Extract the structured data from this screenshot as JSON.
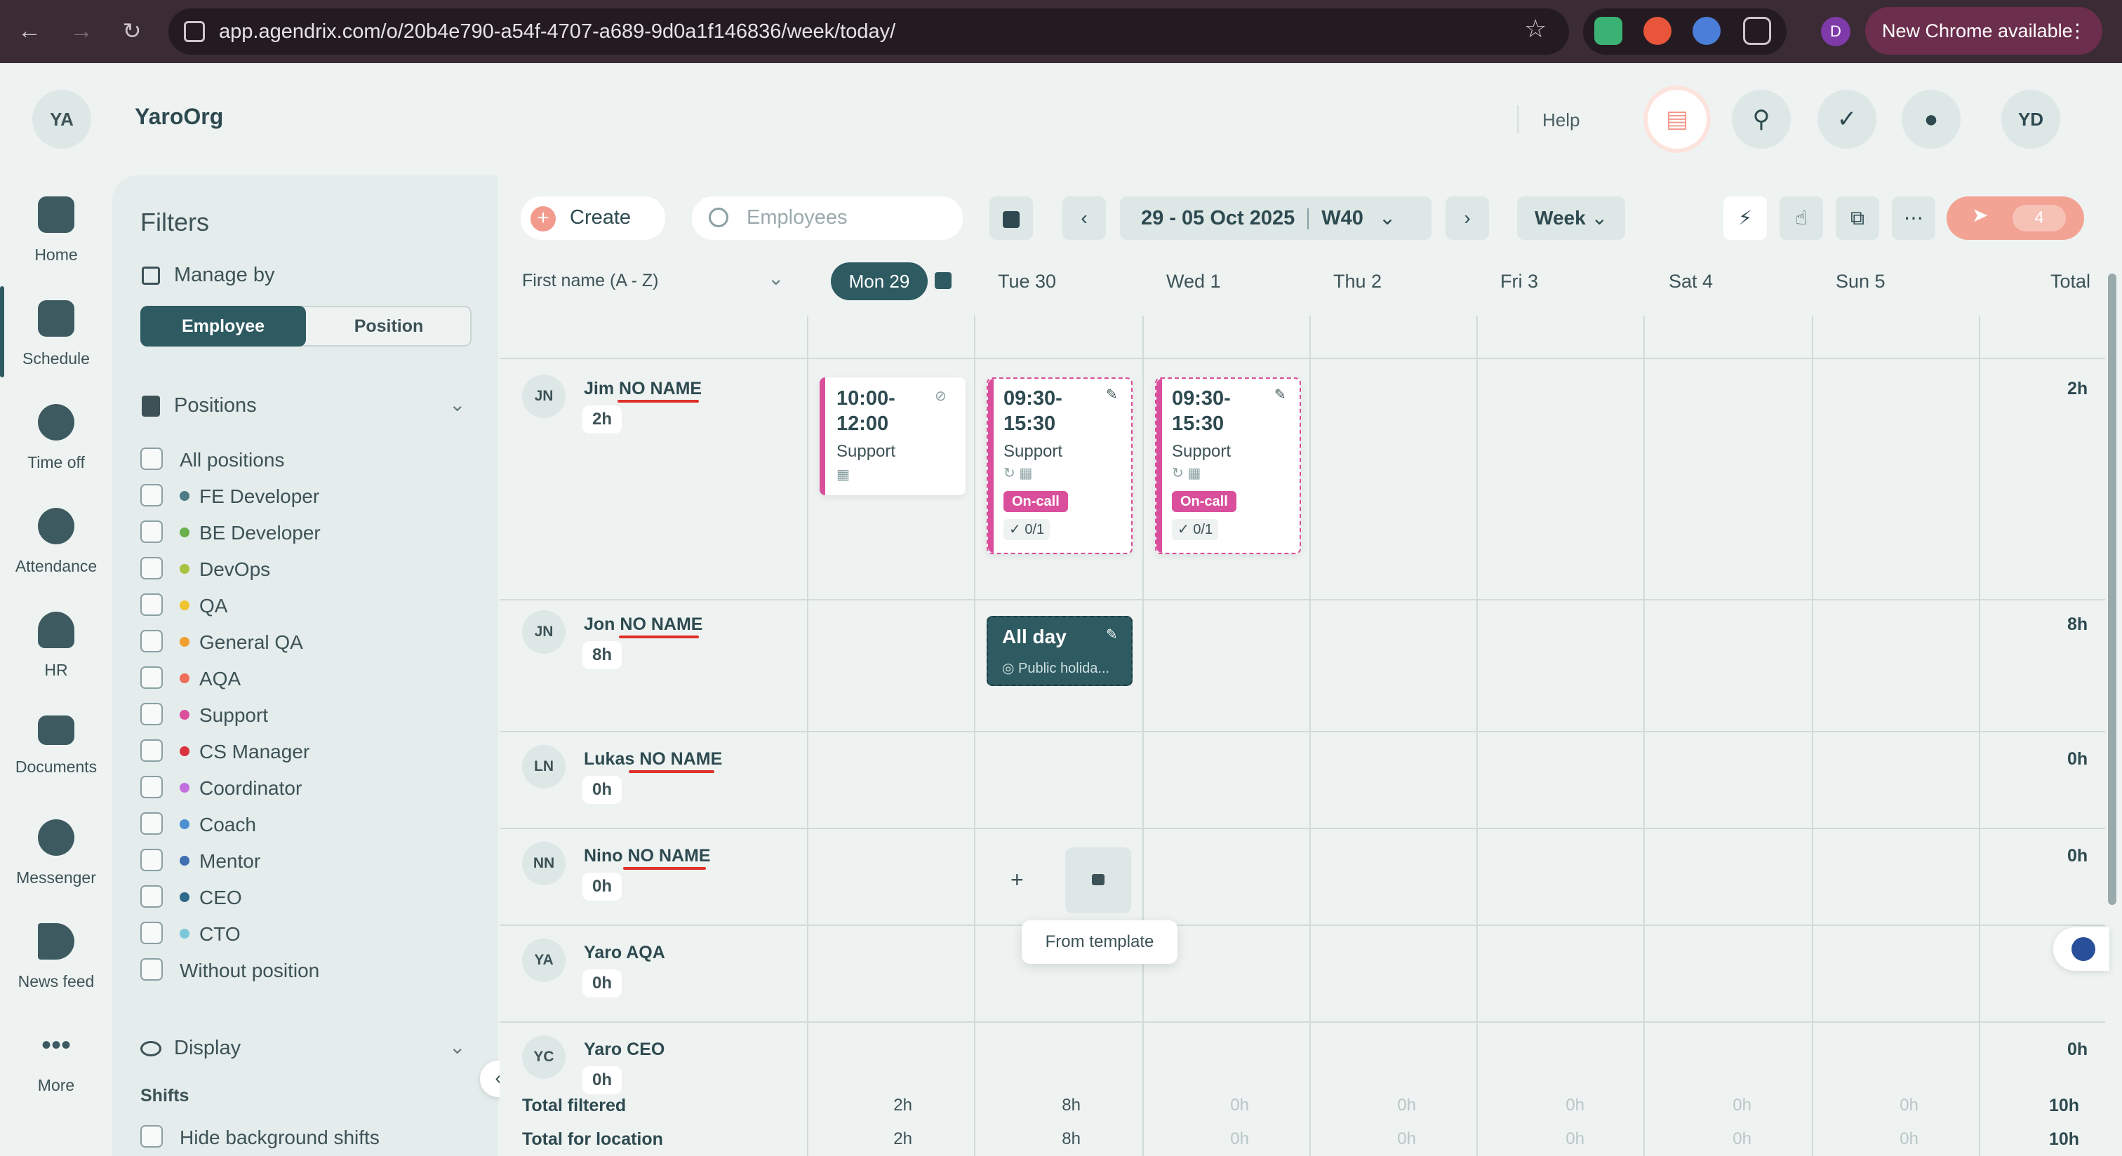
{
  "browser": {
    "url": "app.agendrix.com/o/20b4e790-a54f-4707-a689-9d0a1f146836/week/today/",
    "profile_initial": "D",
    "update_label": "New Chrome available"
  },
  "header": {
    "org_initials": "YA",
    "org_name": "YaroOrg",
    "help_label": "Help",
    "user_initials": "YD"
  },
  "nav": {
    "items": [
      {
        "label": "Home"
      },
      {
        "label": "Schedule"
      },
      {
        "label": "Time off"
      },
      {
        "label": "Attendance"
      },
      {
        "label": "HR"
      },
      {
        "label": "Documents"
      },
      {
        "label": "Messenger"
      },
      {
        "label": "News feed"
      },
      {
        "label": "More"
      }
    ]
  },
  "filters": {
    "title": "Filters",
    "manage_by_label": "Manage by",
    "employee_label": "Employee",
    "position_label": "Position",
    "positions_label": "Positions",
    "positions": [
      {
        "label": "All positions",
        "color": ""
      },
      {
        "label": "FE Developer",
        "color": "#4d7c86"
      },
      {
        "label": "BE Developer",
        "color": "#6ab04c"
      },
      {
        "label": "DevOps",
        "color": "#a9c23f"
      },
      {
        "label": "QA",
        "color": "#f0c430"
      },
      {
        "label": "General QA",
        "color": "#f0a030"
      },
      {
        "label": "AQA",
        "color": "#ef6f5a"
      },
      {
        "label": "Support",
        "color": "#d94f9b"
      },
      {
        "label": "CS Manager",
        "color": "#d8333f"
      },
      {
        "label": "Coordinator",
        "color": "#c36fe0"
      },
      {
        "label": "Coach",
        "color": "#4d8fd0"
      },
      {
        "label": "Mentor",
        "color": "#3f6fb0"
      },
      {
        "label": "CEO",
        "color": "#2e6a8a"
      },
      {
        "label": "CTO",
        "color": "#7ac8d8"
      },
      {
        "label": "Without position",
        "color": ""
      }
    ],
    "display_label": "Display",
    "shifts_label": "Shifts",
    "hide_bg_label": "Hide background shifts"
  },
  "toolbar": {
    "create_label": "Create",
    "search_placeholder": "Employees",
    "range_label": "29 - 05 Oct 2025",
    "week_no": "W40",
    "view_label": "Week",
    "publish_count": "4"
  },
  "grid": {
    "sort_label": "First name (A - Z)",
    "days": [
      "Mon 29",
      "Tue 30",
      "Wed 1",
      "Thu 2",
      "Fri 3",
      "Sat 4",
      "Sun 5"
    ],
    "total_label": "Total",
    "employees": [
      {
        "initials": "JN",
        "first": "Jim",
        "last": "NO NAME",
        "hours": "2h",
        "total": "2h"
      },
      {
        "initials": "JN",
        "first": "Jon",
        "last": "NO NAME",
        "hours": "8h",
        "total": "8h"
      },
      {
        "initials": "LN",
        "first": "Lukas",
        "last": "NO NAME",
        "hours": "0h",
        "total": "0h"
      },
      {
        "initials": "NN",
        "first": "Nino",
        "last": "NO NAME",
        "hours": "0h",
        "total": "0h"
      },
      {
        "initials": "YA",
        "first": "Yaro AQA",
        "last": "",
        "hours": "0h",
        "total": ""
      },
      {
        "initials": "YC",
        "first": "Yaro CEO",
        "last": "",
        "hours": "0h",
        "total": "0h"
      }
    ],
    "shifts": {
      "jim_mon": {
        "time1": "10:00-",
        "time2": "12:00",
        "position": "Support"
      },
      "jim_tue": {
        "time1": "09:30-",
        "time2": "15:30",
        "position": "Support",
        "badge": "On-call",
        "count": "0/1"
      },
      "jim_wed": {
        "time1": "09:30-",
        "time2": "15:30",
        "position": "Support",
        "badge": "On-call",
        "count": "0/1"
      },
      "jon_tue": {
        "title": "All day",
        "sub": "Public holida..."
      }
    },
    "tooltip": "From template",
    "totals": [
      {
        "label": "Total filtered",
        "values": [
          "2h",
          "8h",
          "0h",
          "0h",
          "0h",
          "0h",
          "0h"
        ],
        "total": "10h"
      },
      {
        "label": "Total for location",
        "values": [
          "2h",
          "8h",
          "0h",
          "0h",
          "0h",
          "0h",
          "0h"
        ],
        "total": "10h"
      }
    ]
  },
  "colors": {
    "primary": "#2e5a61",
    "oncall": "#d94f9b",
    "publish": "#f2a393"
  }
}
